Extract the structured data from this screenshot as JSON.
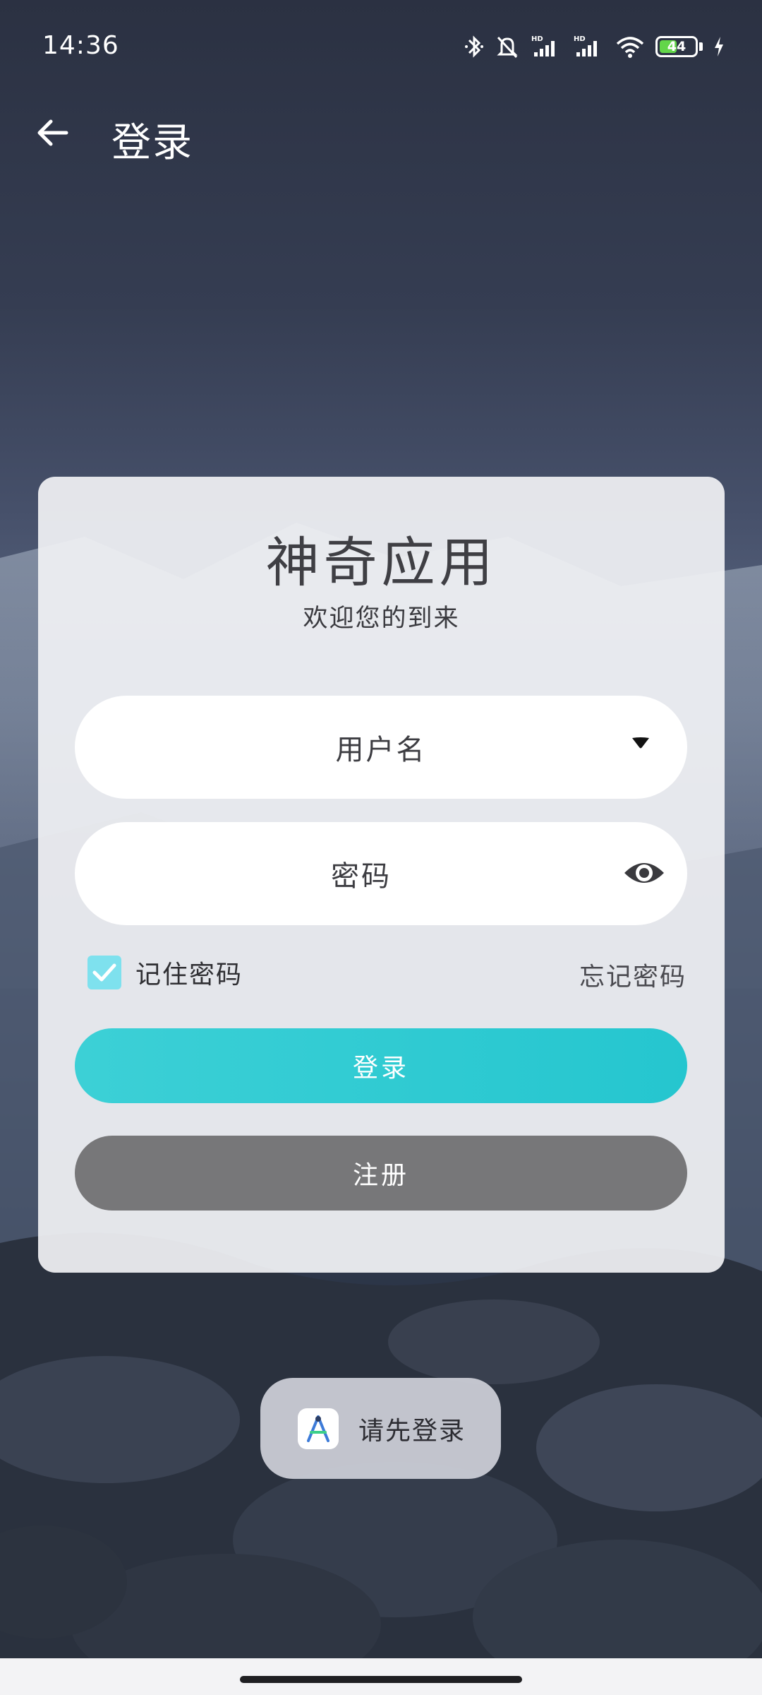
{
  "status_bar": {
    "time": "14:36",
    "battery": "44",
    "icons": [
      "bluetooth-icon",
      "mute-bell-icon",
      "signal-hd-icon",
      "signal-hd-icon",
      "wifi-icon",
      "battery-icon",
      "charging-icon"
    ]
  },
  "app_bar": {
    "title": "登录",
    "back_icon": "arrow-left-icon"
  },
  "card": {
    "app_name": "神奇应用",
    "welcome": "欢迎您的到来",
    "username_placeholder": "用户名",
    "password_placeholder": "密码",
    "remember_label": "记住密码",
    "remember_checked": true,
    "forgot_label": "忘记密码",
    "login_label": "登录",
    "register_label": "注册"
  },
  "toast": {
    "text": "请先登录",
    "icon": "android-studio-icon"
  },
  "colors": {
    "accent": "#2BC9D2",
    "register_button": "#777779",
    "checkbox": "#7EE1EE",
    "battery_fill": "#63D64A"
  }
}
